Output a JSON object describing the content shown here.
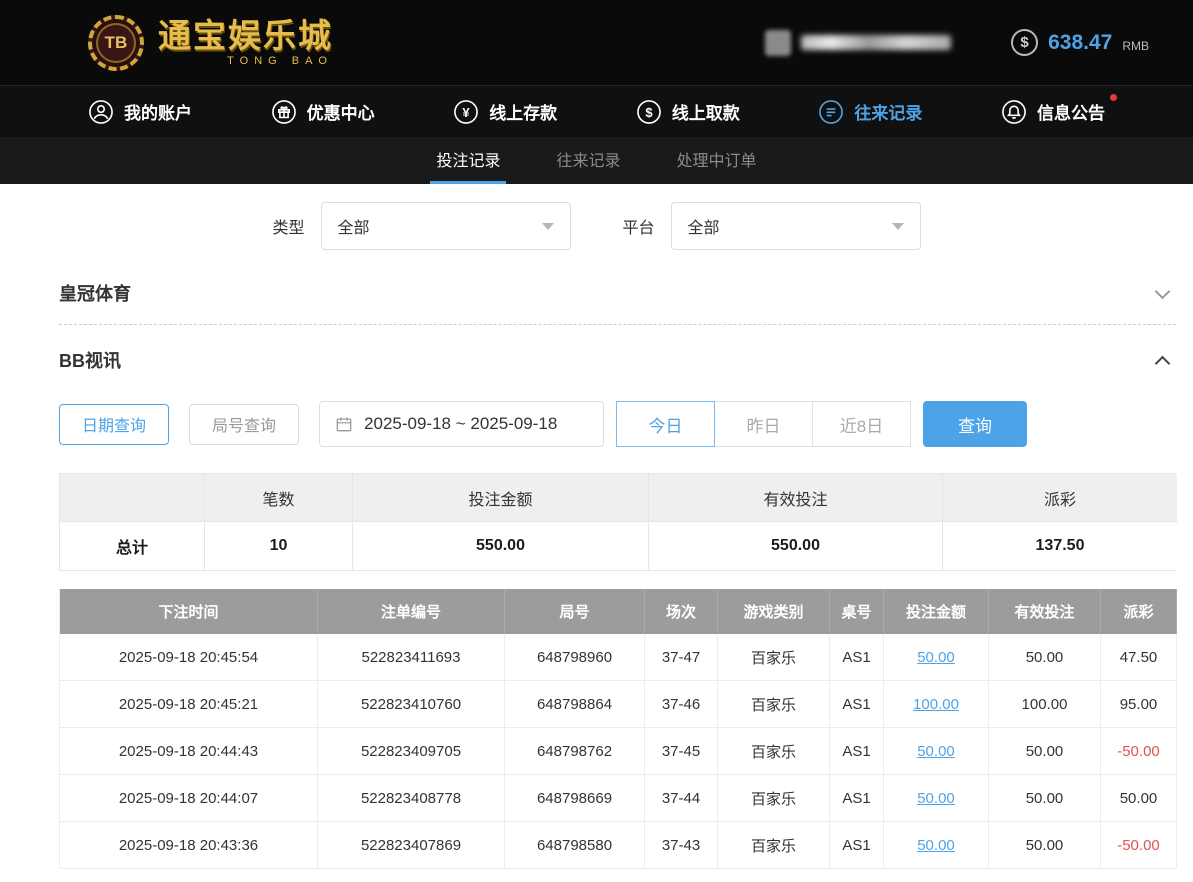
{
  "colors": {
    "accent": "#4da3e8",
    "negative": "#e05252",
    "gold": "#e6bd4a",
    "table_header_bg": "#9c9c9c"
  },
  "header": {
    "logo_chip": "TB",
    "logo_title": "通宝娱乐城",
    "logo_subtitle": "TONG BAO",
    "balance_icon": "$",
    "balance": "638.47",
    "currency": "RMB"
  },
  "nav": {
    "items": [
      {
        "label": "我的账户",
        "icon": "user-icon"
      },
      {
        "label": "优惠中心",
        "icon": "gift-icon"
      },
      {
        "label": "线上存款",
        "icon": "deposit-coin-icon"
      },
      {
        "label": "线上取款",
        "icon": "withdraw-coin-icon"
      },
      {
        "label": "往来记录",
        "icon": "record-icon",
        "active": true
      },
      {
        "label": "信息公告",
        "icon": "bell-icon",
        "badge": true
      }
    ]
  },
  "subtabs": {
    "items": [
      {
        "label": "投注记录",
        "active": true
      },
      {
        "label": "往来记录"
      },
      {
        "label": "处理中订单"
      }
    ]
  },
  "filters": {
    "type_label": "类型",
    "type_value": "全部",
    "platform_label": "平台",
    "platform_value": "全部"
  },
  "sections": {
    "crown": "皇冠体育",
    "bb": "BB视讯"
  },
  "query": {
    "date_query": "日期查询",
    "round_query": "局号查询",
    "date_range": "2025-09-18 ~ 2025-09-18",
    "today": "今日",
    "yesterday": "昨日",
    "last8": "近8日",
    "search": "查询"
  },
  "summary": {
    "headers": [
      "笔数",
      "投注金额",
      "有效投注",
      "派彩"
    ],
    "total_label": "总计",
    "count": "10",
    "bet_amount": "550.00",
    "valid_bet": "550.00",
    "payout": "137.50"
  },
  "table": {
    "headers": [
      "下注时间",
      "注单编号",
      "局号",
      "场次",
      "游戏类别",
      "桌号",
      "投注金额",
      "有效投注",
      "派彩"
    ],
    "rows": [
      {
        "time": "2025-09-18 20:45:54",
        "bet_id": "522823411693",
        "round": "648798960",
        "session": "37-47",
        "game": "百家乐",
        "table_no": "AS1",
        "bet_amount": "50.00",
        "valid_bet": "50.00",
        "payout": "47.50"
      },
      {
        "time": "2025-09-18 20:45:21",
        "bet_id": "522823410760",
        "round": "648798864",
        "session": "37-46",
        "game": "百家乐",
        "table_no": "AS1",
        "bet_amount": "100.00",
        "valid_bet": "100.00",
        "payout": "95.00"
      },
      {
        "time": "2025-09-18 20:44:43",
        "bet_id": "522823409705",
        "round": "648798762",
        "session": "37-45",
        "game": "百家乐",
        "table_no": "AS1",
        "bet_amount": "50.00",
        "valid_bet": "50.00",
        "payout": "-50.00"
      },
      {
        "time": "2025-09-18 20:44:07",
        "bet_id": "522823408778",
        "round": "648798669",
        "session": "37-44",
        "game": "百家乐",
        "table_no": "AS1",
        "bet_amount": "50.00",
        "valid_bet": "50.00",
        "payout": "50.00"
      },
      {
        "time": "2025-09-18 20:43:36",
        "bet_id": "522823407869",
        "round": "648798580",
        "session": "37-43",
        "game": "百家乐",
        "table_no": "AS1",
        "bet_amount": "50.00",
        "valid_bet": "50.00",
        "payout": "-50.00"
      }
    ]
  }
}
